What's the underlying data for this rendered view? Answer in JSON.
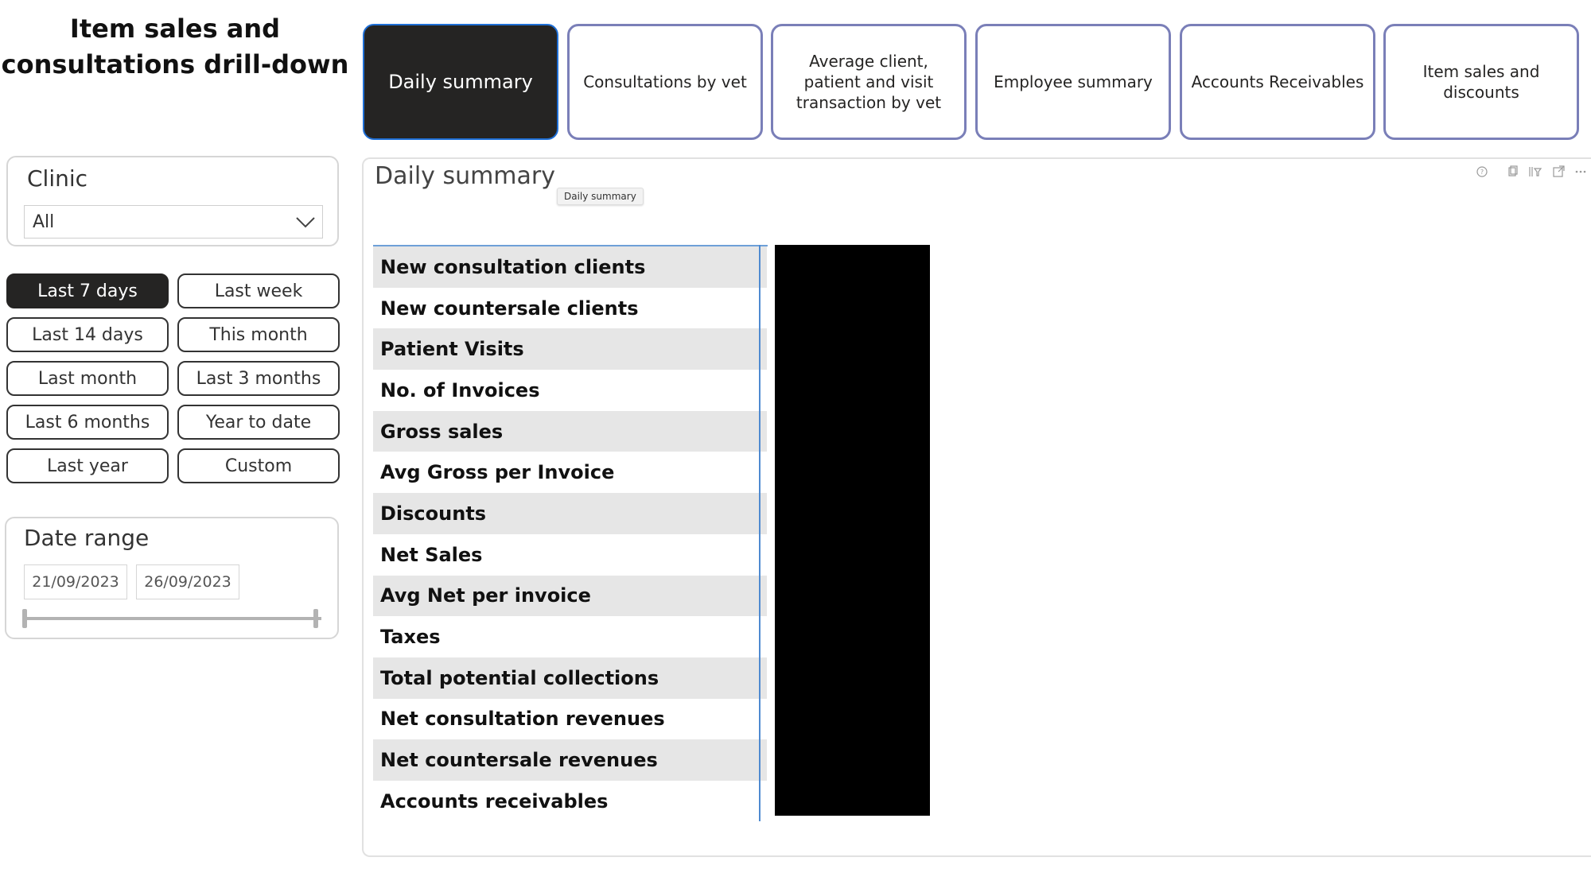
{
  "page": {
    "title": "Item sales and consultations drill-down"
  },
  "nav_tabs": [
    {
      "label": "Daily summary",
      "active": true
    },
    {
      "label": "Consultations by vet",
      "active": false
    },
    {
      "label": "Average client, patient and visit transaction by vet",
      "active": false
    },
    {
      "label": "Employee summary",
      "active": false
    },
    {
      "label": "Accounts Receivables",
      "active": false
    },
    {
      "label": "Item sales and discounts",
      "active": false
    }
  ],
  "clinic_filter": {
    "title": "Clinic",
    "selected": "All",
    "icon": "chevron-down-icon"
  },
  "period_buttons": [
    {
      "label": "Last 7 days",
      "active": true
    },
    {
      "label": "Last week",
      "active": false
    },
    {
      "label": "Last 14 days",
      "active": false
    },
    {
      "label": "This month",
      "active": false
    },
    {
      "label": "Last month",
      "active": false
    },
    {
      "label": "Last 3 months",
      "active": false
    },
    {
      "label": "Last 6 months",
      "active": false
    },
    {
      "label": "Year to date",
      "active": false
    },
    {
      "label": "Last year",
      "active": false
    },
    {
      "label": "Custom",
      "active": false
    }
  ],
  "date_range": {
    "title": "Date range",
    "start": "21/09/2023",
    "end": "26/09/2023"
  },
  "visual": {
    "title": "Daily summary",
    "tooltip": "Daily summary",
    "header_icons": [
      "help-icon",
      "copy-icon",
      "filter-icon",
      "focus-mode-icon",
      "more-options-icon"
    ],
    "rows": [
      "New consultation clients",
      "New countersale clients",
      "Patient Visits",
      "No. of Invoices",
      "Gross sales",
      "Avg Gross per Invoice",
      "Discounts",
      "Net Sales",
      "Avg Net per invoice",
      "Taxes",
      "Total potential collections",
      "Net consultation revenues",
      "Net countersale revenues",
      "Accounts receivables"
    ],
    "values_redacted": true
  },
  "colors": {
    "active_fill": "#252423",
    "tab_border": "#7a7fb8",
    "active_border": "#1f6fd6",
    "row_shade": "#e6e6e6",
    "divider": "#4f8ad0",
    "redaction": "#000000"
  }
}
